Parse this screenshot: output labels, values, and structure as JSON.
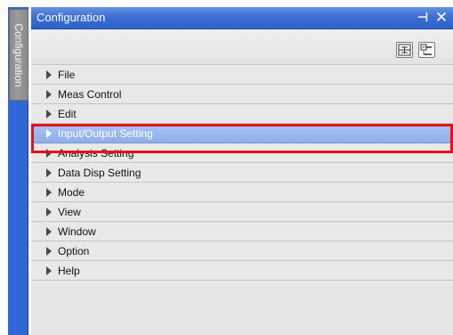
{
  "panel": {
    "title": "Configuration",
    "side_tab_label": "Configuration",
    "pin_glyph": "⊣",
    "close_glyph": "✕"
  },
  "toolbar": {
    "buttons": [
      {
        "icon": "expand-all-icon"
      },
      {
        "icon": "collapse-all-icon"
      }
    ]
  },
  "tree": {
    "items": [
      {
        "label": "File"
      },
      {
        "label": "Meas Control"
      },
      {
        "label": "Edit"
      },
      {
        "label": "Input/Output Setting",
        "selected": true
      },
      {
        "label": "Analysis Setting"
      },
      {
        "label": "Data Disp Setting"
      },
      {
        "label": "Mode"
      },
      {
        "label": "View"
      },
      {
        "label": "Window"
      },
      {
        "label": "Option"
      },
      {
        "label": "Help"
      }
    ]
  },
  "colors": {
    "title_bar": "#3e6fd4",
    "selected_row": "#9cb9ef",
    "highlight_outline": "#e4121b",
    "side_strip": "#2f67d6"
  }
}
